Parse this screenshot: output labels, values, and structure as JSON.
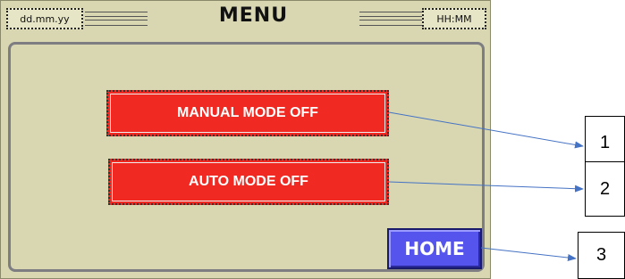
{
  "header": {
    "date_placeholder": "dd.mm.yy",
    "title": "MENU",
    "time_placeholder": "HH:MM"
  },
  "buttons": {
    "manual_mode": "MANUAL MODE OFF",
    "auto_mode": "AUTO MODE OFF",
    "home": "HOME"
  },
  "callouts": [
    "1",
    "2",
    "3"
  ],
  "colors": {
    "panel_background": "#d8d7b2",
    "mode_button_off": "#f02a22",
    "home_button": "#5555ee",
    "callout_arrow": "#4472c4"
  }
}
